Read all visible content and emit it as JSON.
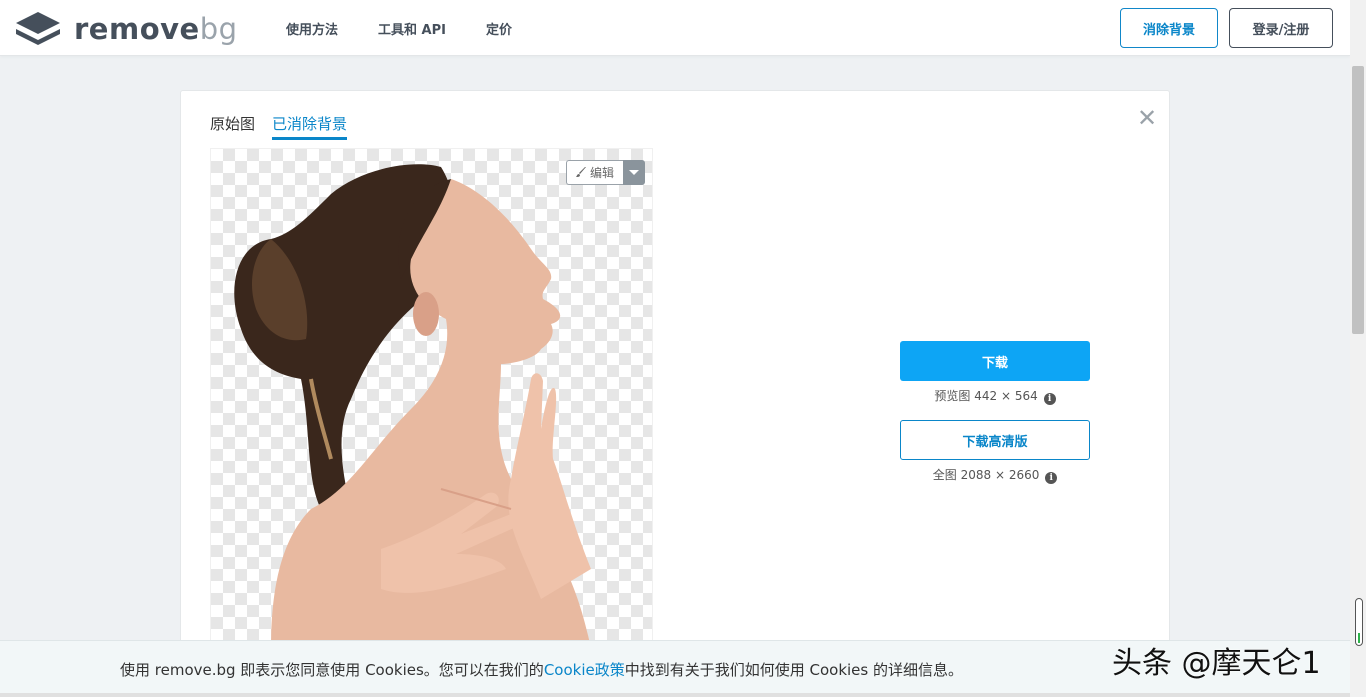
{
  "header": {
    "logo_word_a": "remove",
    "logo_word_b": "bg",
    "nav": [
      "使用方法",
      "工具和 API",
      "定价"
    ],
    "remove_bg_button": "消除背景",
    "login_button": "登录/注册"
  },
  "card": {
    "tabs": [
      {
        "label": "原始图",
        "active": false
      },
      {
        "label": "已消除背景",
        "active": true
      }
    ],
    "close_symbol": "✕",
    "edit_label": "编辑",
    "download": {
      "button_label": "下载",
      "preview_info": "预览图 442 × 564",
      "hd_button_label": "下载高清版",
      "full_info": "全图 2088 × 2660"
    }
  },
  "cookie": {
    "text_before": "使用 remove.bg 即表示您同意使用 Cookies。您可以在我们的",
    "link_text": "Cookie政策",
    "text_after": "中找到有关于我们如何使用 Cookies 的详细信息。"
  },
  "watermark": "头条 @摩天仑1",
  "colors": {
    "accent": "#0a86c9",
    "primary_button": "#0da5f5",
    "page_bg": "#eef1f3",
    "dark_text": "#454f5b"
  },
  "icons": {
    "logo": "stacked-layers-logo",
    "close": "close-icon",
    "edit": "brush-icon",
    "caret": "caret-down-icon",
    "info": "info-icon"
  }
}
